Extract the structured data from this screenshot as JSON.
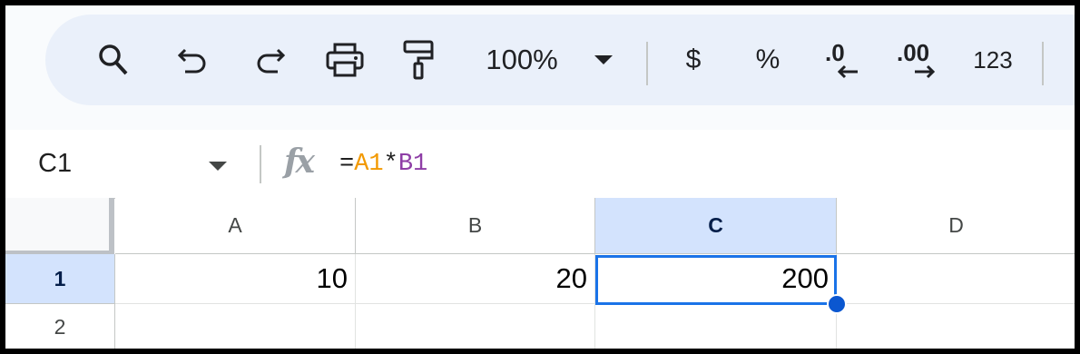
{
  "toolbar": {
    "zoom": "100%",
    "currency": "$",
    "percent": "%",
    "decrease_decimals": ".0",
    "increase_decimals": ".00",
    "more_formats": "123",
    "icons": [
      "search-icon",
      "undo-icon",
      "redo-icon",
      "print-icon",
      "paint-format-icon",
      "dropdown-arrow-icon",
      "arrow-left-icon",
      "arrow-right-icon"
    ]
  },
  "formula_bar": {
    "name_box": "C1",
    "fx": "fx",
    "formula": {
      "eq": "=",
      "ref1": "A1",
      "op": "*",
      "ref2": "B1"
    }
  },
  "grid": {
    "columns": [
      "A",
      "B",
      "C",
      "D"
    ],
    "rows": [
      "1",
      "2"
    ],
    "cells": {
      "A1": "10",
      "B1": "20",
      "C1": "200",
      "D1": "",
      "A2": "",
      "B2": "",
      "C2": "",
      "D2": ""
    },
    "selected_cell": "C1"
  },
  "colors": {
    "selection": "#1a73e8",
    "header_selected_bg": "#d3e3fd",
    "formula_ref_a1": "#f29900",
    "formula_ref_b1": "#8e3ea6"
  }
}
